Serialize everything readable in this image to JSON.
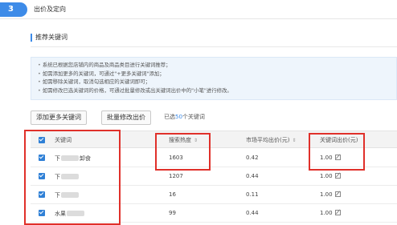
{
  "step": {
    "number": "3",
    "title": "出价及定向"
  },
  "section": {
    "title": "推荐关键词"
  },
  "tips": [
    "系统已根据您店铺内的商品及商品类目进行关键词推荐；",
    "如需添加更多的关键词，可通过\"+更多关键词\"添加；",
    "如需移除关键词，取消勾选相应的关键词即可；",
    "如需修改已选关键词的价格，可通过批量修改或出关键词出价中的\"小笔\"进行修改。"
  ],
  "toolbar": {
    "add_label": "添加更多关键词",
    "batch_label": "批量修改出价",
    "selected_prefix": "已选",
    "selected_count": "50",
    "selected_suffix": "个关键词"
  },
  "table": {
    "headers": [
      "关键词",
      "搜索热度",
      "市场平均出价(元)",
      "关键词出价(元)"
    ],
    "rows": [
      {
        "kw_start": "下",
        "kw_end": "卸食",
        "heat": "1603",
        "avg": "0.42",
        "bid": "1.00"
      },
      {
        "kw_start": "下",
        "kw_end": "",
        "heat": "1207",
        "avg": "0.44",
        "bid": "1.00"
      },
      {
        "kw_start": "下",
        "kw_end": "",
        "heat": "16",
        "avg": "0.11",
        "bid": "1.00"
      },
      {
        "kw_start": "水果",
        "kw_end": "",
        "heat": "99",
        "avg": "0.44",
        "bid": "1.00"
      }
    ]
  },
  "colors": {
    "accent": "#3d8be8",
    "highlight": "#e0302a"
  }
}
